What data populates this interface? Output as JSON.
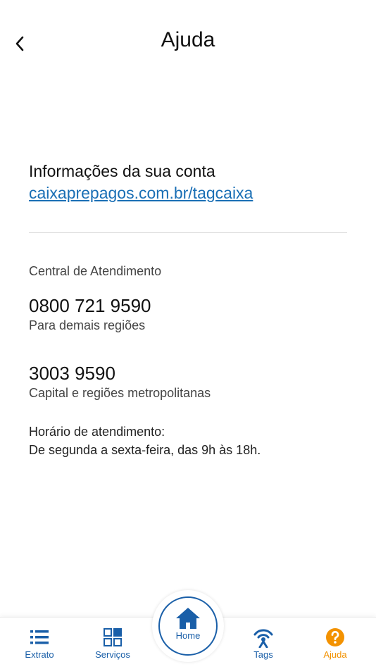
{
  "header": {
    "title": "Ajuda",
    "back_icon": "chevron-left-icon"
  },
  "account": {
    "title": "Informações da sua conta",
    "link": "caixaprepagos.com.br/tagcaixa"
  },
  "contact": {
    "section_label": "Central de Atendimento",
    "numbers": [
      {
        "phone": "0800 721 9590",
        "description": "Para demais regiões"
      },
      {
        "phone": "3003 9590",
        "description": "Capital e regiões metropolitanas"
      }
    ],
    "hours_title": "Horário de atendimento:",
    "hours_text": "De segunda a sexta-feira, das 9h às 18h."
  },
  "bottom_nav": {
    "items": [
      {
        "label": "Extrato",
        "icon": "list-icon"
      },
      {
        "label": "Serviços",
        "icon": "grid-icon"
      },
      {
        "label": "Home",
        "icon": "home-icon"
      },
      {
        "label": "Tags",
        "icon": "tag-signal-icon"
      },
      {
        "label": "Ajuda",
        "icon": "help-icon",
        "active": true
      }
    ]
  },
  "colors": {
    "brand_blue": "#1a5fa8",
    "link_blue": "#1a6fb5",
    "active_orange": "#f39200"
  }
}
